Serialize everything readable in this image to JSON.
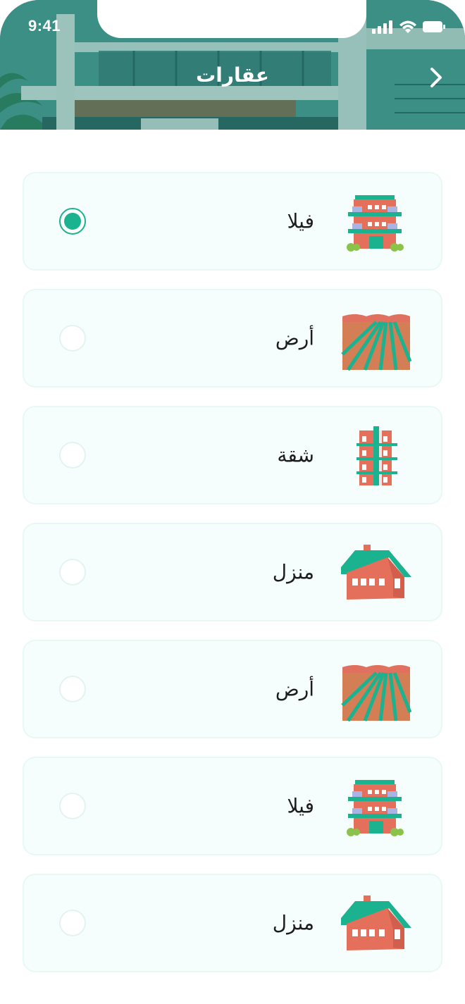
{
  "status_bar": {
    "time": "9:41"
  },
  "header": {
    "title": "عقارات"
  },
  "selected_index": 0,
  "items": [
    {
      "label": "فيلا",
      "icon": "villa-building-icon",
      "selected": true
    },
    {
      "label": "أرض",
      "icon": "land-field-icon",
      "selected": false
    },
    {
      "label": "شقة",
      "icon": "apartment-building-icon",
      "selected": false
    },
    {
      "label": "منزل",
      "icon": "house-icon",
      "selected": false
    },
    {
      "label": "أرض",
      "icon": "land-field-icon",
      "selected": false
    },
    {
      "label": "فيلا",
      "icon": "villa-building-icon",
      "selected": false
    },
    {
      "label": "منزل",
      "icon": "house-icon",
      "selected": false
    }
  ],
  "colors": {
    "accent": "#1ab28f",
    "card_bg": "#f6fefd",
    "card_border": "#e9f8f5"
  }
}
